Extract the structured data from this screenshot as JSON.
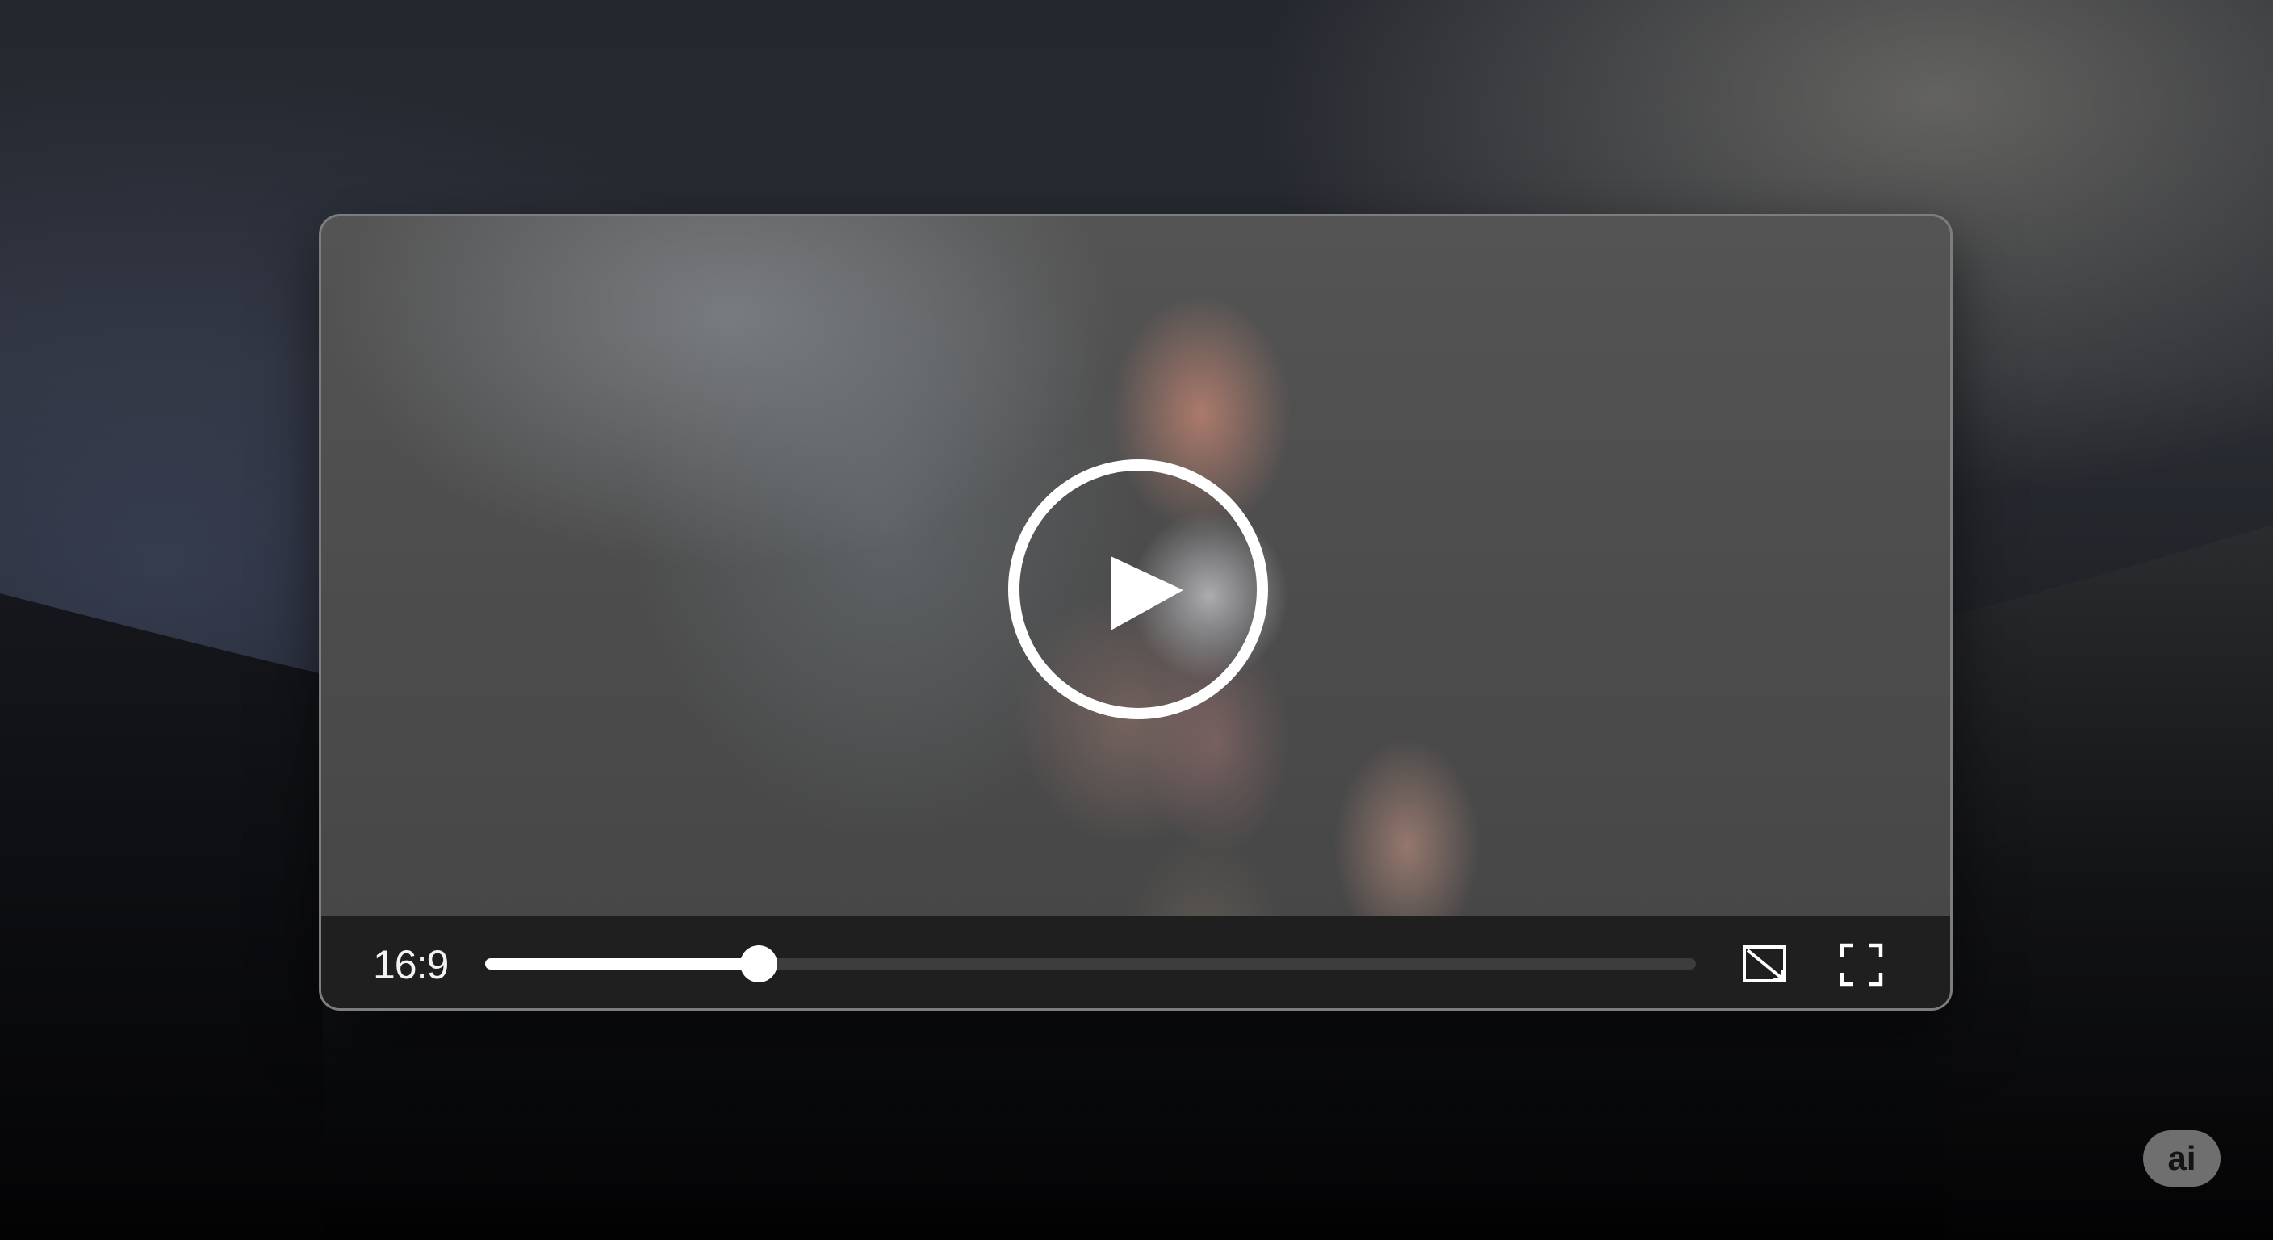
{
  "player": {
    "aspect_ratio": "16:9",
    "progress": 0.226,
    "play_button": "play-icon",
    "controls": {
      "pip_icon": "picture-in-picture-icon",
      "fullscreen_icon": "fullscreen-icon"
    }
  },
  "badge": {
    "label": "ai"
  },
  "colors": {
    "control_bar": "#1f1f1f",
    "progress_fill": "#ffffff",
    "progress_track": "#3d3d3d",
    "badge_bg": "#6f6f6f"
  }
}
